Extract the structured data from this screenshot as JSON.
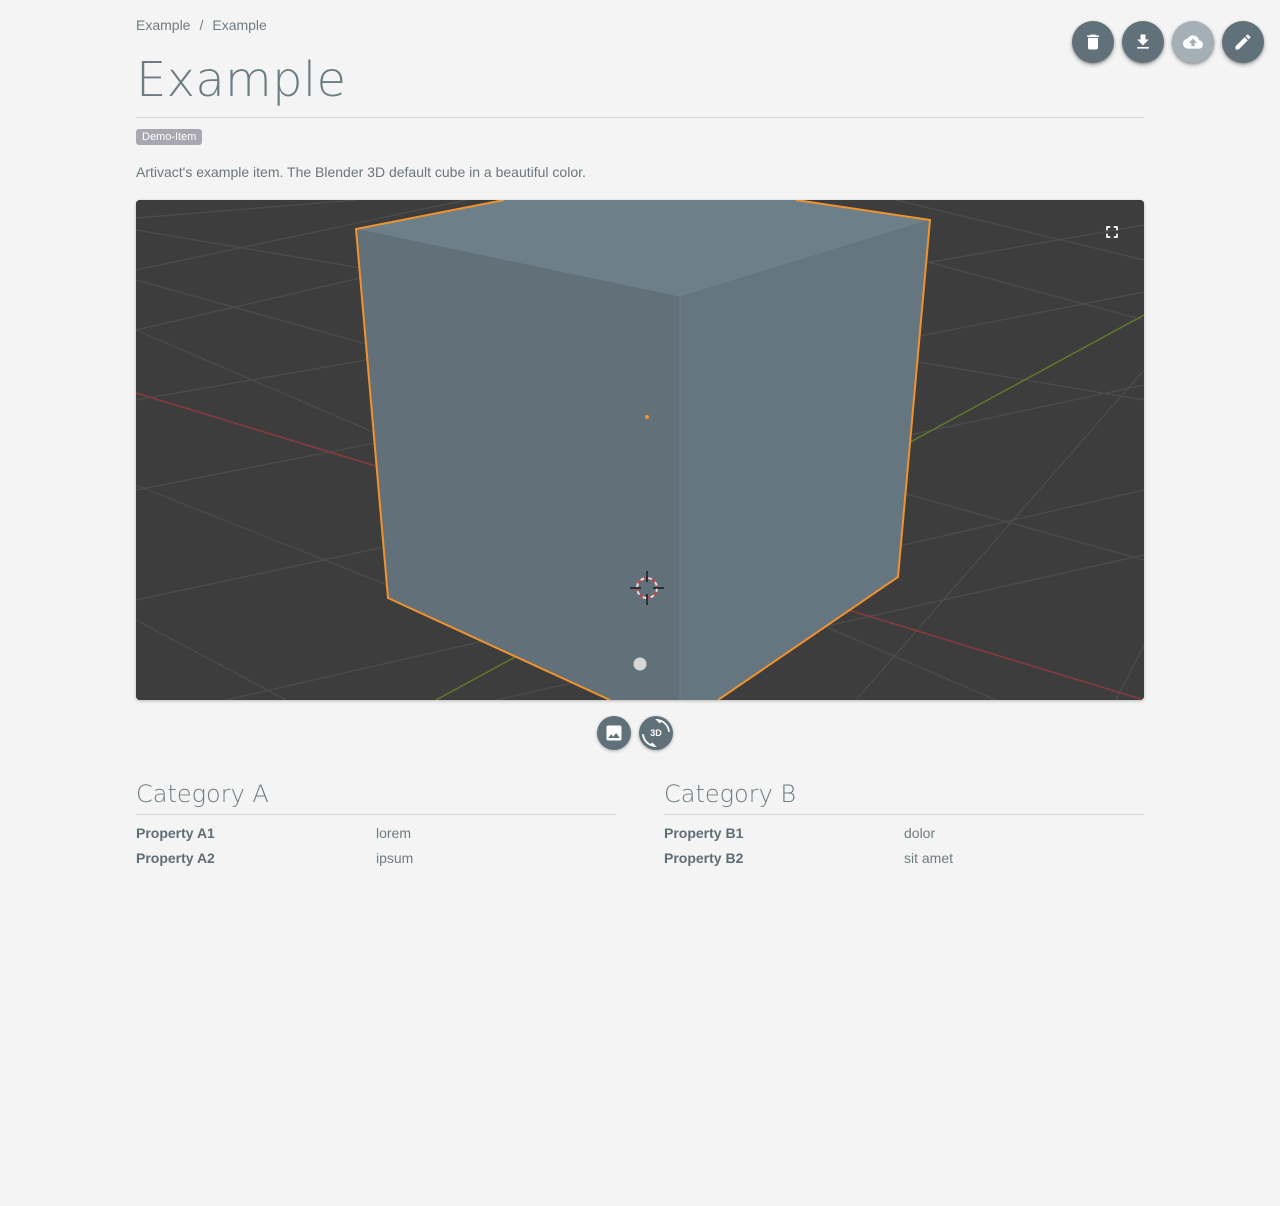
{
  "breadcrumb": {
    "items": [
      "Example",
      "Example"
    ],
    "separator": "/"
  },
  "actions": {
    "delete_icon": "trash-icon",
    "download_icon": "download-icon",
    "upload_icon": "cloud-upload-icon",
    "edit_icon": "pencil-icon"
  },
  "item": {
    "title": "Example",
    "tag": "Demo-Item",
    "description": "Artivact's example item. The Blender 3D default cube in a beautiful color."
  },
  "viewer": {
    "fullscreen_icon": "fullscreen-icon",
    "modes": [
      "image-icon",
      "3d-rotate-icon"
    ],
    "threed_label": "3D",
    "background_color": "#3d3d3d",
    "cube_color": "#6a7c85",
    "outline_color": "#f0922e"
  },
  "categories": [
    {
      "title": "Category A",
      "properties": [
        {
          "name": "Property A1",
          "value": "lorem"
        },
        {
          "name": "Property A2",
          "value": "ipsum"
        }
      ]
    },
    {
      "title": "Category B",
      "properties": [
        {
          "name": "Property B1",
          "value": "dolor"
        },
        {
          "name": "Property B2",
          "value": "sit amet"
        }
      ]
    }
  ]
}
